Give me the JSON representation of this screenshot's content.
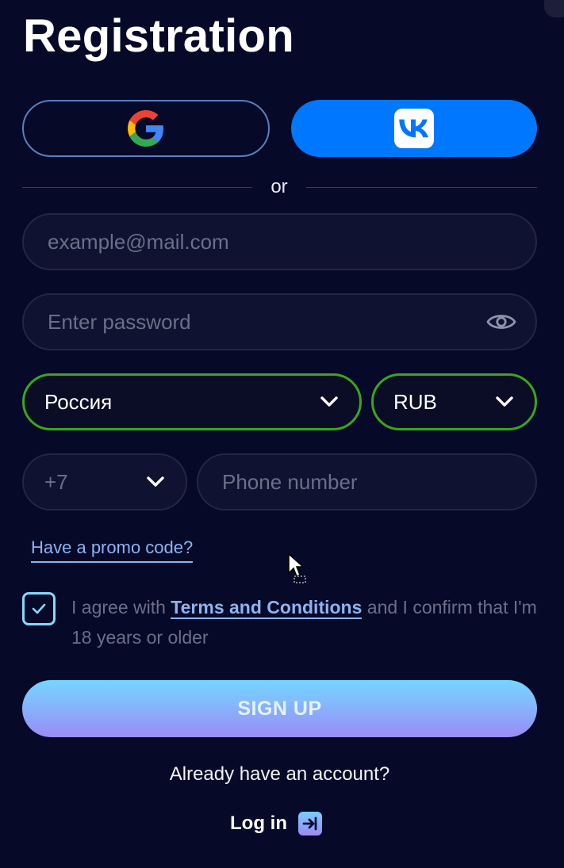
{
  "page": {
    "title": "Registration"
  },
  "social": {
    "google": {
      "icon": "google-logo-icon"
    },
    "vk": {
      "icon": "vk-logo-icon",
      "color": "#0077ff"
    }
  },
  "divider": {
    "text": "or"
  },
  "email": {
    "value": "",
    "placeholder": "example@mail.com"
  },
  "password": {
    "value": "",
    "placeholder": "Enter password",
    "toggle_icon": "eye-icon"
  },
  "country": {
    "selected": "Россия",
    "icon": "chevron-down-icon"
  },
  "currency": {
    "selected": "RUB",
    "icon": "chevron-down-icon"
  },
  "phone": {
    "code": "+7",
    "value": "",
    "placeholder": "Phone number"
  },
  "promo": {
    "label": "Have a promo code?"
  },
  "agreement": {
    "checked": true,
    "text_before": "I agree with ",
    "link": "Terms and Conditions",
    "text_after": " and I confirm that I'm 18 years or older"
  },
  "signup": {
    "label": "SIGN UP"
  },
  "login": {
    "prompt": "Already have an account?",
    "label": "Log in",
    "icon": "login-arrow-icon"
  },
  "colors": {
    "background": "#070928",
    "field": "#0f1230",
    "accent_link": "#8bb4f2",
    "valid_border": "#3aa61a",
    "gradient_start": "#75d6ff",
    "gradient_end": "#9a8cf7"
  }
}
